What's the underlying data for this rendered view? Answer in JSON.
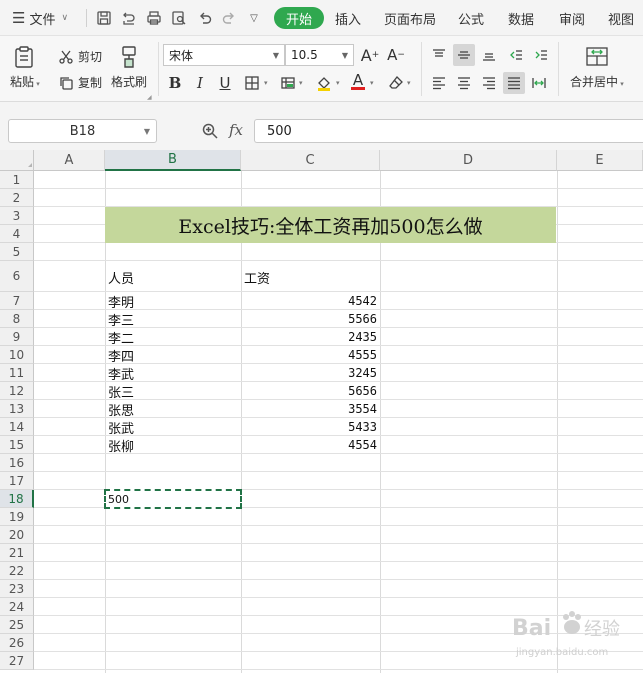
{
  "menubar": {
    "file_menu": "文件",
    "tabs": [
      "开始",
      "插入",
      "页面布局",
      "公式",
      "数据",
      "审阅",
      "视图"
    ],
    "active_tab": "开始"
  },
  "ribbon": {
    "paste": "粘贴",
    "cut": "剪切",
    "copy": "复制",
    "format_painter": "格式刷",
    "font_name": "宋体",
    "font_size": "10.5",
    "merge_center": "合并居中"
  },
  "formula_bar": {
    "cell_ref": "B18",
    "fx_label": "fx",
    "value": "500"
  },
  "sheet": {
    "columns": [
      "A",
      "B",
      "C",
      "D",
      "E"
    ],
    "selected_column": "B",
    "rows": [
      "1",
      "2",
      "3",
      "4",
      "5",
      "6",
      "7",
      "8",
      "9",
      "10",
      "11",
      "12",
      "13",
      "14",
      "15",
      "16",
      "17",
      "18",
      "19",
      "20",
      "21",
      "22",
      "23",
      "24",
      "25",
      "26",
      "27"
    ],
    "selected_row": "18",
    "title": "Excel技巧:全体工资再加500怎么做",
    "header_name": "人员",
    "header_salary": "工资",
    "records": [
      {
        "name": "李明",
        "salary": "4542"
      },
      {
        "name": "李三",
        "salary": "5566"
      },
      {
        "name": "李二",
        "salary": "2435"
      },
      {
        "name": "李四",
        "salary": "4555"
      },
      {
        "name": "李武",
        "salary": "3245"
      },
      {
        "name": "张三",
        "salary": "5656"
      },
      {
        "name": "张思",
        "salary": "3554"
      },
      {
        "name": "张武",
        "salary": "5433"
      },
      {
        "name": "张柳",
        "salary": "4554"
      }
    ],
    "b18_value": "500"
  },
  "watermark": {
    "brand": "Bai",
    "brand_cn": "经验",
    "domain": "jingyan.baidu.com"
  },
  "colors": {
    "accent_green": "#2fa84f",
    "title_fill": "#c4d79b",
    "selection": "#217346"
  }
}
